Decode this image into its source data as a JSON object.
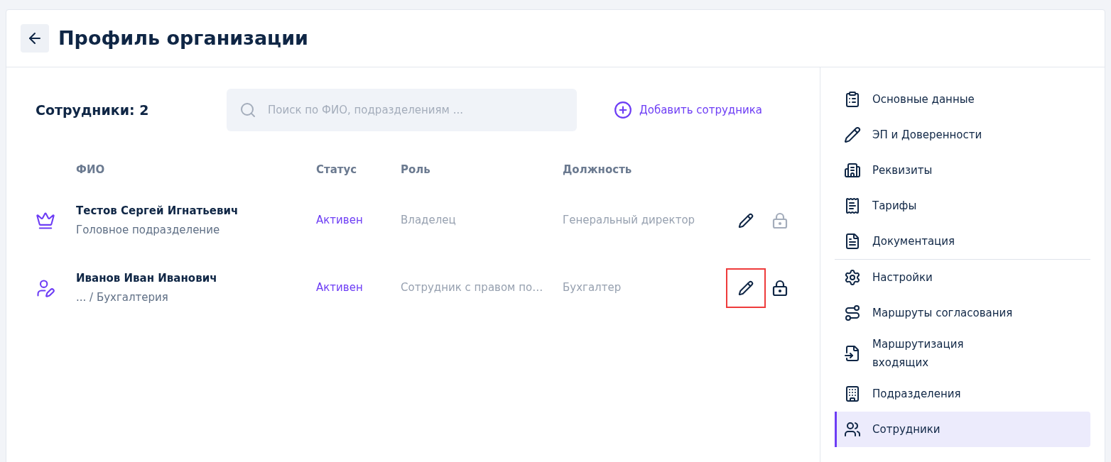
{
  "header": {
    "title": "Профиль организации"
  },
  "employees": {
    "title": "Сотрудники: 2",
    "search": {
      "placeholder": "Поиск по ФИО, подразделениям ..."
    },
    "add_button": "Добавить сотрудника"
  },
  "table": {
    "columns": [
      "ФИО",
      "Статус",
      "Роль",
      "Должность"
    ],
    "rows": [
      {
        "kind": "owner",
        "name": "Тестов Сергей Игнатьевич",
        "department": "Головное подразделение",
        "status": "Активен",
        "role": "Владелец",
        "position": "Генеральный директор",
        "edit_highlighted": false,
        "lock_disabled": true
      },
      {
        "kind": "signer",
        "name": "Иванов Иван Иванович",
        "department": "... / Бухгалтерия",
        "status": "Активен",
        "role": "Сотрудник с правом по…",
        "position": "Бухгалтер",
        "edit_highlighted": true,
        "lock_disabled": false
      }
    ]
  },
  "sidebar": {
    "sections": [
      {
        "items": [
          {
            "label": "Основные данные",
            "selected": false
          },
          {
            "label": "ЭП и Доверенности",
            "selected": false
          },
          {
            "label": "Реквизиты",
            "selected": false
          },
          {
            "label": "Тарифы",
            "selected": false
          },
          {
            "label": "Документация",
            "selected": false
          }
        ]
      },
      {
        "items": [
          {
            "label": "Настройки",
            "selected": false
          },
          {
            "label": "Маршруты согласования",
            "selected": false
          },
          {
            "label": "Маршрутизация\nвходящих",
            "selected": false
          },
          {
            "label": "Подразделения",
            "selected": false
          },
          {
            "label": "Сотрудники",
            "selected": true
          }
        ]
      }
    ]
  }
}
